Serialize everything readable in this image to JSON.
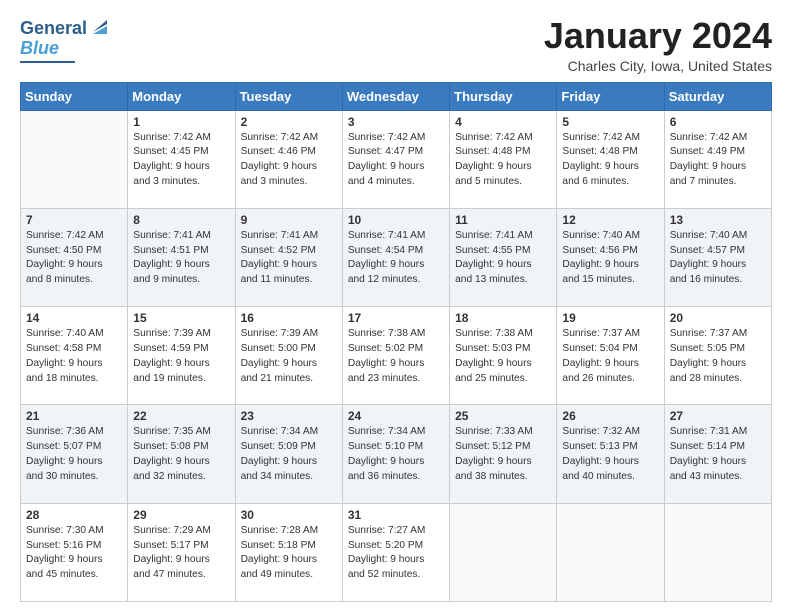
{
  "header": {
    "logo_line1": "General",
    "logo_line2": "Blue",
    "month_title": "January 2024",
    "location": "Charles City, Iowa, United States"
  },
  "days_of_week": [
    "Sunday",
    "Monday",
    "Tuesday",
    "Wednesday",
    "Thursday",
    "Friday",
    "Saturday"
  ],
  "weeks": [
    [
      {
        "num": "",
        "info": ""
      },
      {
        "num": "1",
        "info": "Sunrise: 7:42 AM\nSunset: 4:45 PM\nDaylight: 9 hours\nand 3 minutes."
      },
      {
        "num": "2",
        "info": "Sunrise: 7:42 AM\nSunset: 4:46 PM\nDaylight: 9 hours\nand 3 minutes."
      },
      {
        "num": "3",
        "info": "Sunrise: 7:42 AM\nSunset: 4:47 PM\nDaylight: 9 hours\nand 4 minutes."
      },
      {
        "num": "4",
        "info": "Sunrise: 7:42 AM\nSunset: 4:48 PM\nDaylight: 9 hours\nand 5 minutes."
      },
      {
        "num": "5",
        "info": "Sunrise: 7:42 AM\nSunset: 4:48 PM\nDaylight: 9 hours\nand 6 minutes."
      },
      {
        "num": "6",
        "info": "Sunrise: 7:42 AM\nSunset: 4:49 PM\nDaylight: 9 hours\nand 7 minutes."
      }
    ],
    [
      {
        "num": "7",
        "info": "Sunrise: 7:42 AM\nSunset: 4:50 PM\nDaylight: 9 hours\nand 8 minutes."
      },
      {
        "num": "8",
        "info": "Sunrise: 7:41 AM\nSunset: 4:51 PM\nDaylight: 9 hours\nand 9 minutes."
      },
      {
        "num": "9",
        "info": "Sunrise: 7:41 AM\nSunset: 4:52 PM\nDaylight: 9 hours\nand 11 minutes."
      },
      {
        "num": "10",
        "info": "Sunrise: 7:41 AM\nSunset: 4:54 PM\nDaylight: 9 hours\nand 12 minutes."
      },
      {
        "num": "11",
        "info": "Sunrise: 7:41 AM\nSunset: 4:55 PM\nDaylight: 9 hours\nand 13 minutes."
      },
      {
        "num": "12",
        "info": "Sunrise: 7:40 AM\nSunset: 4:56 PM\nDaylight: 9 hours\nand 15 minutes."
      },
      {
        "num": "13",
        "info": "Sunrise: 7:40 AM\nSunset: 4:57 PM\nDaylight: 9 hours\nand 16 minutes."
      }
    ],
    [
      {
        "num": "14",
        "info": "Sunrise: 7:40 AM\nSunset: 4:58 PM\nDaylight: 9 hours\nand 18 minutes."
      },
      {
        "num": "15",
        "info": "Sunrise: 7:39 AM\nSunset: 4:59 PM\nDaylight: 9 hours\nand 19 minutes."
      },
      {
        "num": "16",
        "info": "Sunrise: 7:39 AM\nSunset: 5:00 PM\nDaylight: 9 hours\nand 21 minutes."
      },
      {
        "num": "17",
        "info": "Sunrise: 7:38 AM\nSunset: 5:02 PM\nDaylight: 9 hours\nand 23 minutes."
      },
      {
        "num": "18",
        "info": "Sunrise: 7:38 AM\nSunset: 5:03 PM\nDaylight: 9 hours\nand 25 minutes."
      },
      {
        "num": "19",
        "info": "Sunrise: 7:37 AM\nSunset: 5:04 PM\nDaylight: 9 hours\nand 26 minutes."
      },
      {
        "num": "20",
        "info": "Sunrise: 7:37 AM\nSunset: 5:05 PM\nDaylight: 9 hours\nand 28 minutes."
      }
    ],
    [
      {
        "num": "21",
        "info": "Sunrise: 7:36 AM\nSunset: 5:07 PM\nDaylight: 9 hours\nand 30 minutes."
      },
      {
        "num": "22",
        "info": "Sunrise: 7:35 AM\nSunset: 5:08 PM\nDaylight: 9 hours\nand 32 minutes."
      },
      {
        "num": "23",
        "info": "Sunrise: 7:34 AM\nSunset: 5:09 PM\nDaylight: 9 hours\nand 34 minutes."
      },
      {
        "num": "24",
        "info": "Sunrise: 7:34 AM\nSunset: 5:10 PM\nDaylight: 9 hours\nand 36 minutes."
      },
      {
        "num": "25",
        "info": "Sunrise: 7:33 AM\nSunset: 5:12 PM\nDaylight: 9 hours\nand 38 minutes."
      },
      {
        "num": "26",
        "info": "Sunrise: 7:32 AM\nSunset: 5:13 PM\nDaylight: 9 hours\nand 40 minutes."
      },
      {
        "num": "27",
        "info": "Sunrise: 7:31 AM\nSunset: 5:14 PM\nDaylight: 9 hours\nand 43 minutes."
      }
    ],
    [
      {
        "num": "28",
        "info": "Sunrise: 7:30 AM\nSunset: 5:16 PM\nDaylight: 9 hours\nand 45 minutes."
      },
      {
        "num": "29",
        "info": "Sunrise: 7:29 AM\nSunset: 5:17 PM\nDaylight: 9 hours\nand 47 minutes."
      },
      {
        "num": "30",
        "info": "Sunrise: 7:28 AM\nSunset: 5:18 PM\nDaylight: 9 hours\nand 49 minutes."
      },
      {
        "num": "31",
        "info": "Sunrise: 7:27 AM\nSunset: 5:20 PM\nDaylight: 9 hours\nand 52 minutes."
      },
      {
        "num": "",
        "info": ""
      },
      {
        "num": "",
        "info": ""
      },
      {
        "num": "",
        "info": ""
      }
    ]
  ],
  "row_shading": [
    false,
    true,
    false,
    true,
    false
  ]
}
